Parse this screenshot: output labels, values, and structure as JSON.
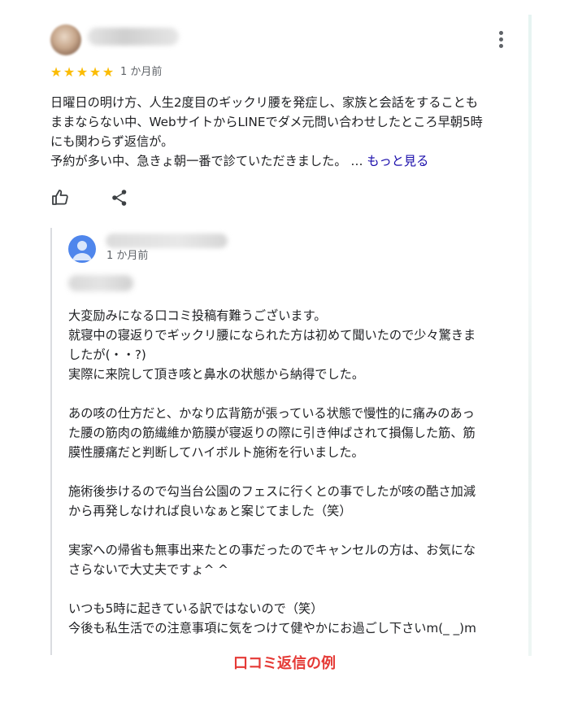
{
  "review": {
    "rating": 5,
    "star_glyph": "★",
    "date": "1 か月前",
    "lines": [
      "日曜日の明け方、人生2度目のギックリ腰を発症し、家族と会話をすることも",
      "ままならない中、WebサイトからLINEでダメ元問い合わせしたところ早朝5時",
      "にも関わらず返信が。",
      "予約が多い中、急きょ朝一番で診ていただきました。 … "
    ],
    "more_label": "もっと見る"
  },
  "actions": {
    "like_icon": "thumbs-up-icon",
    "share_icon": "share-icon"
  },
  "owner_reply": {
    "date": "1 か月前",
    "lines": [
      "大変励みになる口コミ投稿有難うございます。",
      "就寝中の寝返りでギックリ腰になられた方は初めて聞いたので少々驚きま",
      "したが(・・?)",
      "実際に来院して頂き咳と鼻水の状態から納得でした。",
      "",
      "あの咳の仕方だと、かなり広背筋が張っている状態で慢性的に痛みのあっ",
      "た腰の筋肉の筋繊維か筋膜が寝返りの際に引き伸ばされて損傷した筋、筋",
      "膜性腰痛だと判断してハイボルト施術を行いました。",
      "",
      "施術後歩けるので勾当台公園のフェスに行くとの事でしたが咳の酷さ加減",
      "から再発しなければ良いなぁと案じてました（笑）",
      "",
      "実家への帰省も無事出来たとの事だったのでキャンセルの方は、お気にな",
      "さらないで大丈夫ですょ^ ^",
      "",
      "いつも5時に起きている訳ではないので（笑）",
      "今後も私生活での注意事項に気をつけて健やかにお過ごし下さいm(_ _)m"
    ]
  },
  "caption": "口コミ返信の例",
  "colors": {
    "star": "#fbbc04",
    "link": "#1a0dab",
    "caption": "#e53935",
    "owner_avatar": "#4f86ec"
  }
}
